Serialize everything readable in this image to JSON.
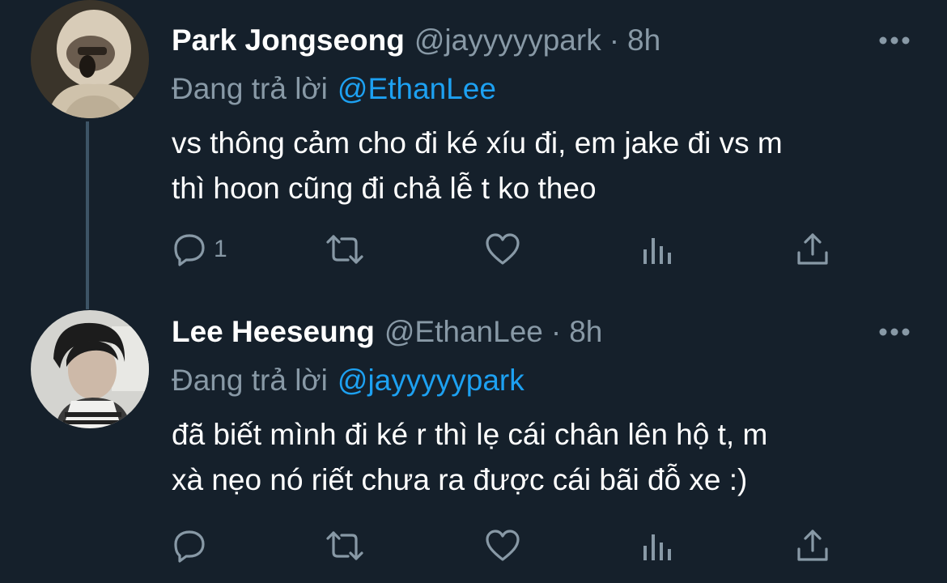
{
  "tweets": [
    {
      "display_name": "Park Jongseong",
      "handle": "@jayyyyypark",
      "separator": "·",
      "time": "8h",
      "reply_prefix": "Đang trả lời",
      "reply_to": "@EthanLee",
      "text_lines": [
        "vs thông cảm cho đi ké xíu đi, em jake đi vs m",
        "thì hoon cũng đi chả lễ t ko theo"
      ],
      "reply_count": "1",
      "icons": [
        "more-icon",
        "reply-icon",
        "retweet-icon",
        "like-icon",
        "analytics-icon",
        "share-icon"
      ]
    },
    {
      "display_name": "Lee Heeseung",
      "handle": "@EthanLee",
      "separator": "·",
      "time": "8h",
      "reply_prefix": "Đang trả lời",
      "reply_to": "@jayyyyypark",
      "text_lines": [
        "đã biết mình đi ké r thì lẹ cái chân lên hộ t, m",
        "xà nẹo nó riết chưa ra được cái bãi đỗ xe :)"
      ],
      "reply_count": "",
      "icons": [
        "more-icon",
        "reply-icon",
        "retweet-icon",
        "like-icon",
        "analytics-icon",
        "share-icon"
      ]
    }
  ],
  "colors": {
    "background": "#15202b",
    "primary_text": "#ffffff",
    "secondary_text": "#8899a6",
    "link": "#1da1f2",
    "thread_line": "#3d5466"
  }
}
